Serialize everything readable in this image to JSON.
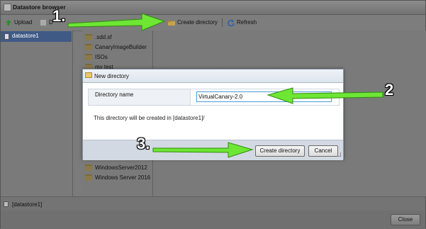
{
  "window": {
    "title": "Datastore browser"
  },
  "toolbar": {
    "upload_label": "Upload",
    "hidden_label": "D",
    "create_dir_label": "Create directory",
    "refresh_label": "Refresh"
  },
  "tree": {
    "datastore_label": "datastore1"
  },
  "folders": {
    "top": [
      ".sdd.sf",
      "CanaryImageBuilder",
      "ISOs",
      "my test"
    ],
    "bottom": [
      "WindowsServer2012",
      "Windows Server 2016"
    ]
  },
  "status": {
    "path": "[datastore1]"
  },
  "footer": {
    "close_label": "Close"
  },
  "dialog": {
    "title": "New directory",
    "field_label": "Directory name",
    "field_value": "VirtualCanary-2.0",
    "info_text": "This directory will be created in [datastore1]/",
    "create_label": "Create directory",
    "cancel_label": "Cancel"
  },
  "annotations": {
    "step1": "1.",
    "step2": "2",
    "step3": "3."
  },
  "colors": {
    "arrow_green": "#6ee634",
    "selection_blue": "#3f5a85",
    "input_focus": "#4a9bd6"
  }
}
